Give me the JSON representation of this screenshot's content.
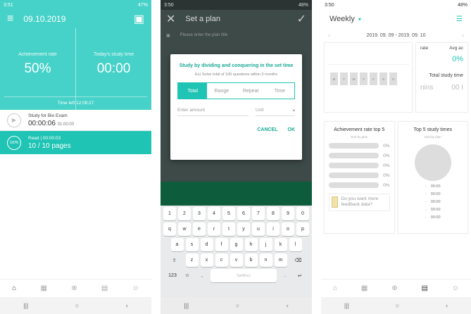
{
  "screen1": {
    "status": {
      "time": "3:51",
      "battery": "47%"
    },
    "header": {
      "date": "09.10.2019"
    },
    "stats": {
      "achievement_label": "Achievement rate",
      "achievement_value": "50%",
      "study_time_label": "Today's study time",
      "study_time_value": "00:00",
      "time_left": "Time left 12:08:27"
    },
    "items": [
      {
        "title": "Study for Bio Exam",
        "value": "00:00:06",
        "small": "01:00:00"
      },
      {
        "title": "Read | 00:00:03",
        "value": "10 / 10 pages",
        "badge": "100%"
      }
    ]
  },
  "screen2": {
    "status": {
      "time": "3:50",
      "battery": "48%"
    },
    "header": {
      "title": "Set a plan"
    },
    "hint_row": "Please enter the plan title",
    "dialog": {
      "title": "Study by dividing and conquering in the set time",
      "subtitle": "Ex) Solve total of 100 questions within 3 months",
      "tabs": [
        "Total",
        "Range",
        "Repeat",
        "Time"
      ],
      "amount_placeholder": "Enter amount",
      "unit_placeholder": "Unit",
      "cancel": "CANCEL",
      "ok": "OK"
    },
    "keyboard": {
      "row1": [
        "1",
        "2",
        "3",
        "4",
        "5",
        "6",
        "7",
        "8",
        "9",
        "0"
      ],
      "row2": [
        "q",
        "w",
        "e",
        "r",
        "t",
        "y",
        "u",
        "i",
        "o",
        "p"
      ],
      "row3": [
        "a",
        "s",
        "d",
        "f",
        "g",
        "h",
        "j",
        "k",
        "l"
      ],
      "row4": [
        "z",
        "x",
        "c",
        "v",
        "b",
        "n",
        "m"
      ],
      "sym": "123",
      "space": "SwiftKey"
    }
  },
  "screen3": {
    "status": {
      "time": "3:50",
      "battery": "48%"
    },
    "header": {
      "title": "Weekly"
    },
    "date_range": "2019. 09. 09 - 2019. 09. 10",
    "weekdays": [
      "M",
      "T",
      "W",
      "T",
      "F",
      "S",
      "S"
    ],
    "rate_card": {
      "rate_label": "rate",
      "avg_label": "Avg ac",
      "avg_value": "0%",
      "total_label": "Total study time",
      "mins": "nins",
      "total_value": "00 I"
    },
    "achievement_top5": {
      "title": "Achievement rate top 5",
      "sub": "Sort by plan",
      "values": [
        "0%",
        "0%",
        "0%",
        "0%",
        "0%"
      ],
      "feedback": "Do you want more feedback data?"
    },
    "study_top5": {
      "title": "Top 5 study times",
      "sub": "Sort by plan",
      "rows": [
        {
          "dash": "-",
          "time": "00:00"
        },
        {
          "dash": "-",
          "time": "00:00"
        },
        {
          "dash": "-",
          "time": "00:00"
        },
        {
          "dash": "-",
          "time": "00:00"
        },
        {
          "dash": "-",
          "time": "00:00"
        }
      ]
    }
  }
}
